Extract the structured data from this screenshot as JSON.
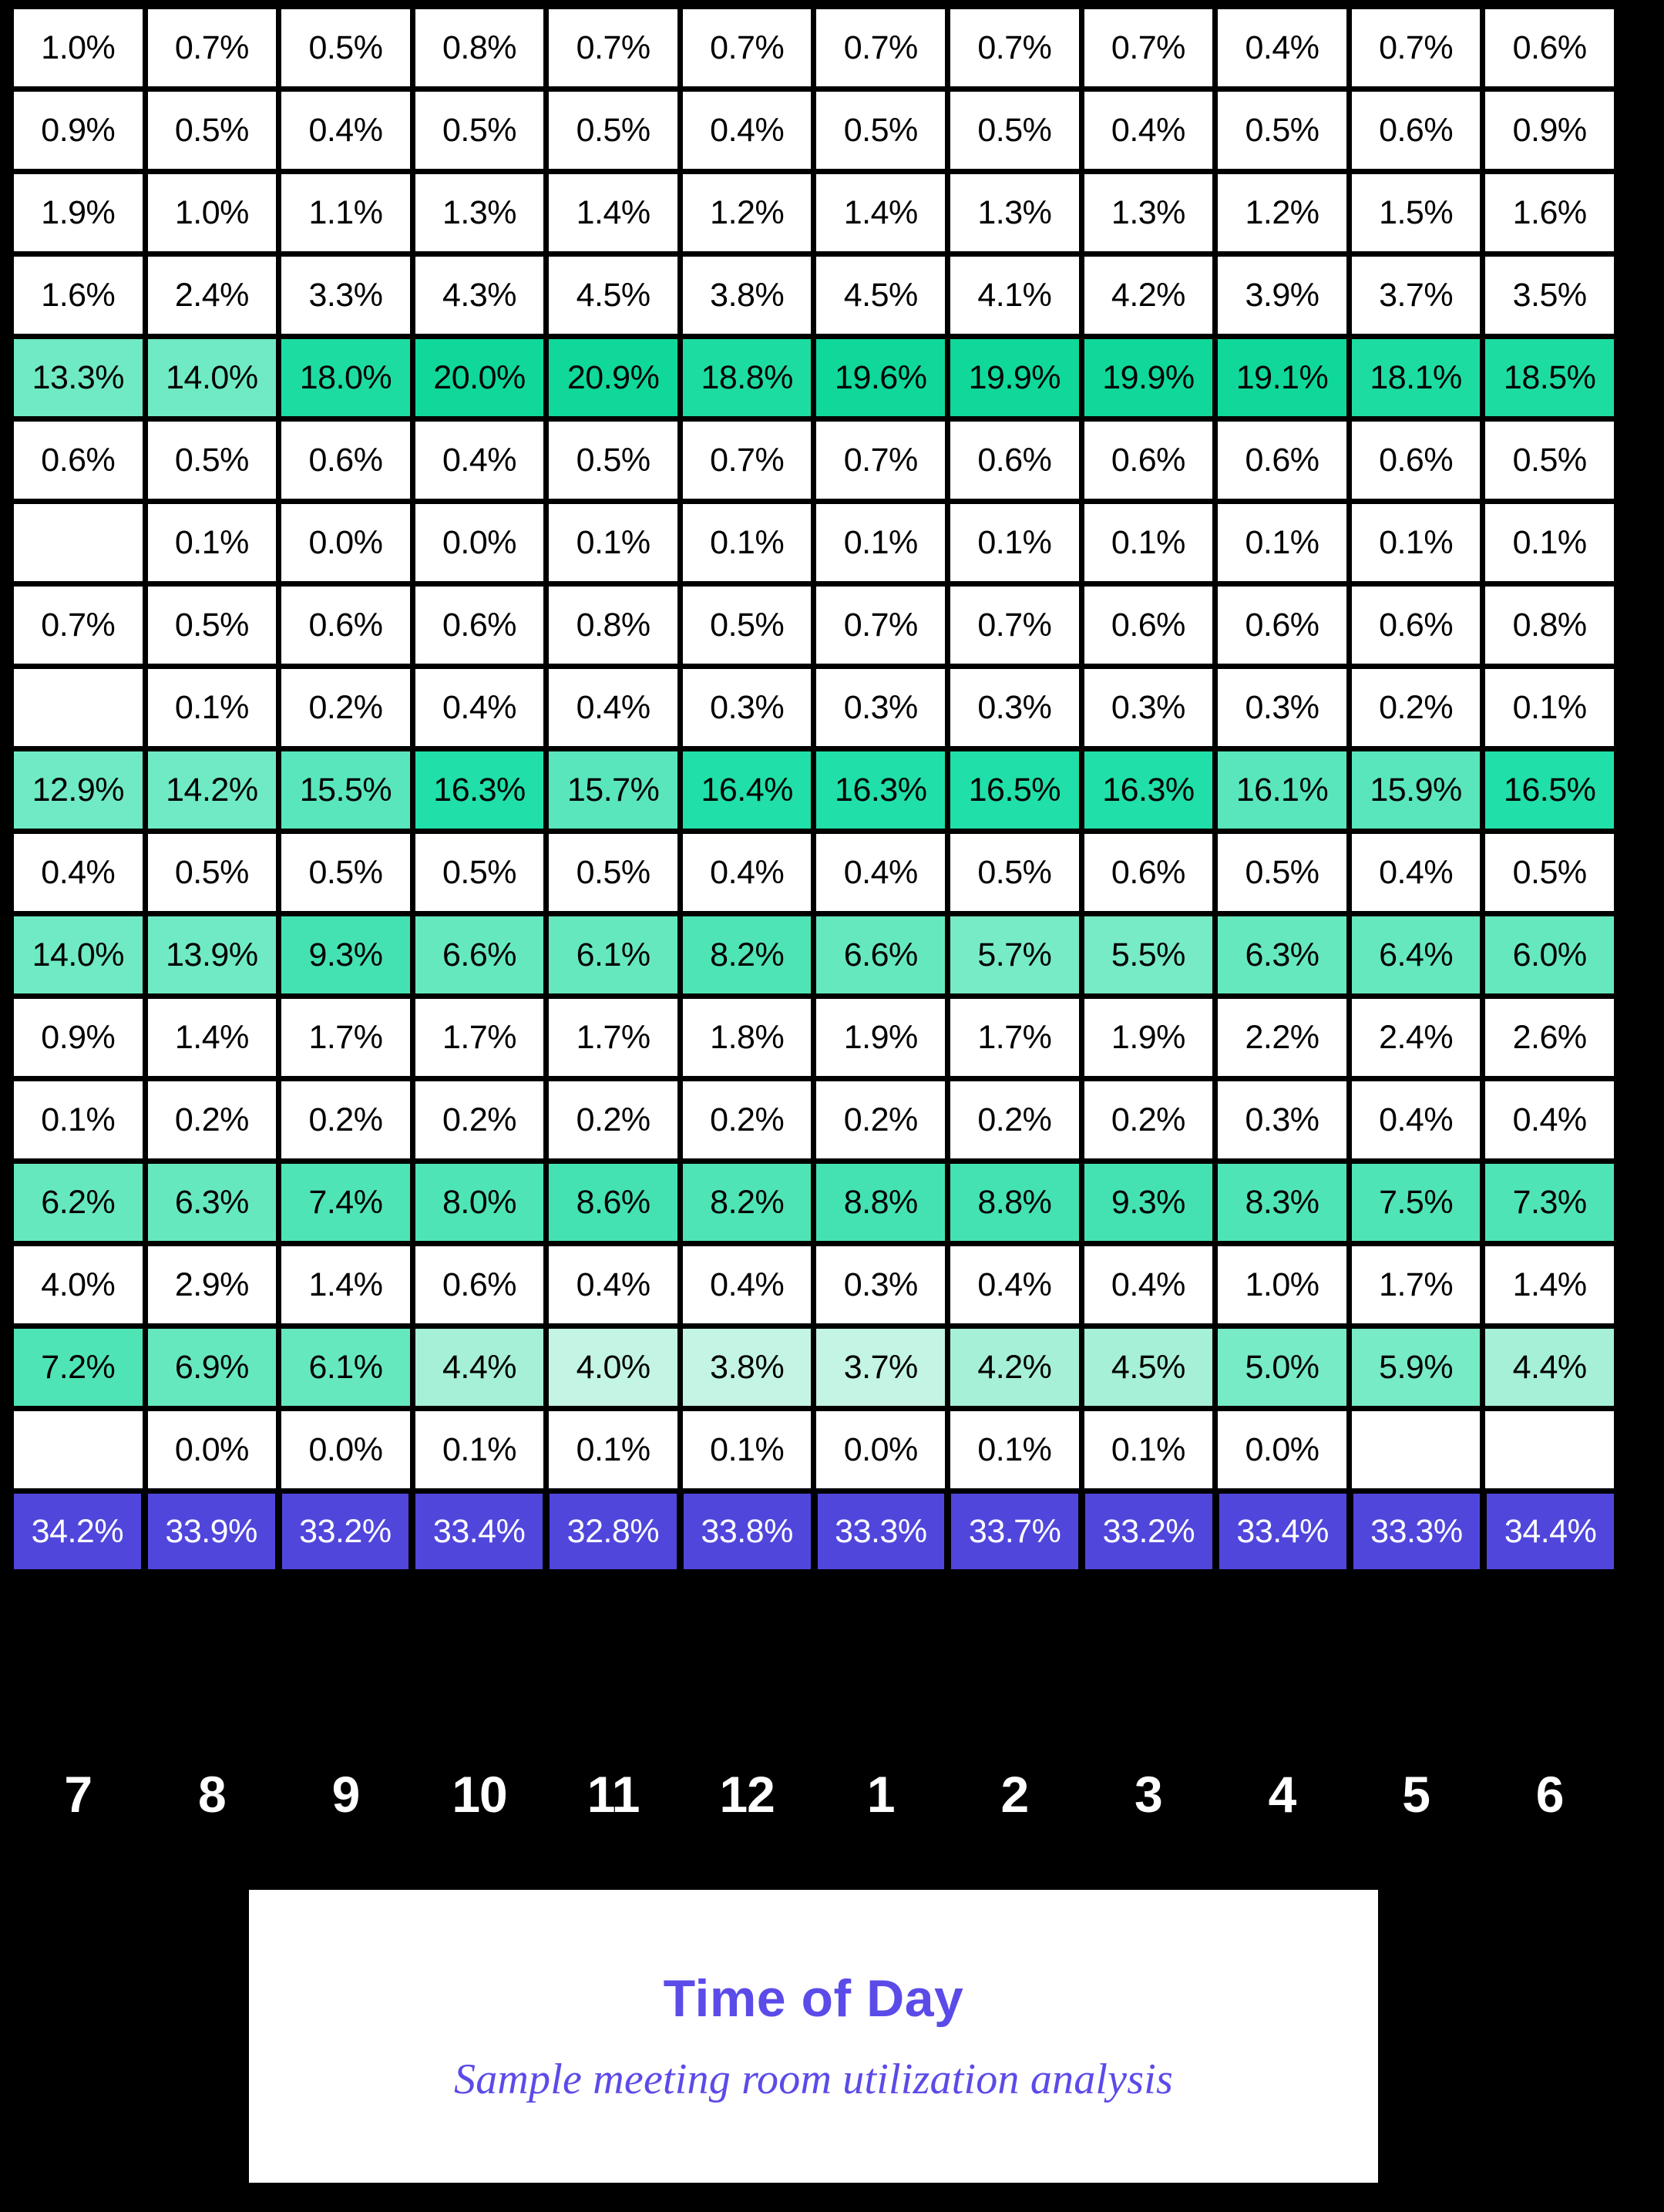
{
  "title": {
    "main": "Time of Day",
    "subtitle": "Sample meeting room utilization analysis",
    "color": "#5B4BE8"
  },
  "colors": {
    "background": "#000000",
    "cell_empty": "#ffffff",
    "text_dark": "#000000",
    "text_light": "#ffffff",
    "total_row": "#5046DC",
    "green_low": "#BDF3E2",
    "green_mid": "#7FEBC8",
    "green_high": "#4DE3B4",
    "green_max": "#10D89A"
  },
  "chart_data": {
    "type": "heatmap",
    "title": "Time of Day",
    "subtitle": "Sample meeting room utilization analysis",
    "xlabel": "Time of Day",
    "ylabel": "",
    "grid": true,
    "legend": "none",
    "x": [
      "7",
      "8",
      "9",
      "10",
      "11",
      "12",
      "1",
      "2",
      "3",
      "4",
      "5",
      "6"
    ],
    "categories": [
      "7",
      "8",
      "9",
      "10",
      "11",
      "12",
      "1",
      "2",
      "3",
      "4",
      "5",
      "6"
    ],
    "value_suffix": "%",
    "rows": [
      {
        "index": 1,
        "highlight": "none",
        "values": [
          "1.0%",
          "0.7%",
          "0.5%",
          "0.8%",
          "0.7%",
          "0.7%",
          "0.7%",
          "0.7%",
          "0.7%",
          "0.4%",
          "0.7%",
          "0.6%"
        ]
      },
      {
        "index": 2,
        "highlight": "none",
        "values": [
          "0.9%",
          "0.5%",
          "0.4%",
          "0.5%",
          "0.5%",
          "0.4%",
          "0.5%",
          "0.5%",
          "0.4%",
          "0.5%",
          "0.6%",
          "0.9%"
        ]
      },
      {
        "index": 3,
        "highlight": "none",
        "values": [
          "1.9%",
          "1.0%",
          "1.1%",
          "1.3%",
          "1.4%",
          "1.2%",
          "1.4%",
          "1.3%",
          "1.3%",
          "1.2%",
          "1.5%",
          "1.6%"
        ]
      },
      {
        "index": 4,
        "highlight": "none",
        "values": [
          "1.6%",
          "2.4%",
          "3.3%",
          "4.3%",
          "4.5%",
          "3.8%",
          "4.5%",
          "4.1%",
          "4.2%",
          "3.9%",
          "3.7%",
          "3.5%"
        ]
      },
      {
        "index": 5,
        "highlight": "green",
        "values": [
          "13.3%",
          "14.0%",
          "18.0%",
          "20.0%",
          "20.9%",
          "18.8%",
          "19.6%",
          "19.9%",
          "19.9%",
          "19.1%",
          "18.1%",
          "18.5%"
        ]
      },
      {
        "index": 6,
        "highlight": "none",
        "values": [
          "0.6%",
          "0.5%",
          "0.6%",
          "0.4%",
          "0.5%",
          "0.7%",
          "0.7%",
          "0.6%",
          "0.6%",
          "0.6%",
          "0.6%",
          "0.5%"
        ]
      },
      {
        "index": 7,
        "highlight": "none",
        "values": [
          "",
          "0.1%",
          "0.0%",
          "0.0%",
          "0.1%",
          "0.1%",
          "0.1%",
          "0.1%",
          "0.1%",
          "0.1%",
          "0.1%",
          "0.1%"
        ]
      },
      {
        "index": 8,
        "highlight": "none",
        "values": [
          "0.7%",
          "0.5%",
          "0.6%",
          "0.6%",
          "0.8%",
          "0.5%",
          "0.7%",
          "0.7%",
          "0.6%",
          "0.6%",
          "0.6%",
          "0.8%"
        ]
      },
      {
        "index": 9,
        "highlight": "none",
        "values": [
          "",
          "0.1%",
          "0.2%",
          "0.4%",
          "0.4%",
          "0.3%",
          "0.3%",
          "0.3%",
          "0.3%",
          "0.3%",
          "0.2%",
          "0.1%"
        ]
      },
      {
        "index": 10,
        "highlight": "green",
        "values": [
          "12.9%",
          "14.2%",
          "15.5%",
          "16.3%",
          "15.7%",
          "16.4%",
          "16.3%",
          "16.5%",
          "16.3%",
          "16.1%",
          "15.9%",
          "16.5%"
        ]
      },
      {
        "index": 11,
        "highlight": "none",
        "values": [
          "0.4%",
          "0.5%",
          "0.5%",
          "0.5%",
          "0.5%",
          "0.4%",
          "0.4%",
          "0.5%",
          "0.6%",
          "0.5%",
          "0.4%",
          "0.5%"
        ]
      },
      {
        "index": 12,
        "highlight": "green",
        "values": [
          "14.0%",
          "13.9%",
          "9.3%",
          "6.6%",
          "6.1%",
          "8.2%",
          "6.6%",
          "5.7%",
          "5.5%",
          "6.3%",
          "6.4%",
          "6.0%"
        ]
      },
      {
        "index": 13,
        "highlight": "none",
        "values": [
          "0.9%",
          "1.4%",
          "1.7%",
          "1.7%",
          "1.7%",
          "1.8%",
          "1.9%",
          "1.7%",
          "1.9%",
          "2.2%",
          "2.4%",
          "2.6%"
        ]
      },
      {
        "index": 14,
        "highlight": "none",
        "values": [
          "0.1%",
          "0.2%",
          "0.2%",
          "0.2%",
          "0.2%",
          "0.2%",
          "0.2%",
          "0.2%",
          "0.2%",
          "0.3%",
          "0.4%",
          "0.4%"
        ]
      },
      {
        "index": 15,
        "highlight": "green",
        "values": [
          "6.2%",
          "6.3%",
          "7.4%",
          "8.0%",
          "8.6%",
          "8.2%",
          "8.8%",
          "8.8%",
          "9.3%",
          "8.3%",
          "7.5%",
          "7.3%"
        ]
      },
      {
        "index": 16,
        "highlight": "none",
        "values": [
          "4.0%",
          "2.9%",
          "1.4%",
          "0.6%",
          "0.4%",
          "0.4%",
          "0.3%",
          "0.4%",
          "0.4%",
          "1.0%",
          "1.7%",
          "1.4%"
        ]
      },
      {
        "index": 17,
        "highlight": "green",
        "values": [
          "7.2%",
          "6.9%",
          "6.1%",
          "4.4%",
          "4.0%",
          "3.8%",
          "3.7%",
          "4.2%",
          "4.5%",
          "5.0%",
          "5.9%",
          "4.4%"
        ]
      },
      {
        "index": 18,
        "highlight": "none",
        "values": [
          "",
          "0.0%",
          "0.0%",
          "0.1%",
          "0.1%",
          "0.1%",
          "0.0%",
          "0.1%",
          "0.1%",
          "0.0%",
          "",
          ""
        ]
      },
      {
        "index": 19,
        "highlight": "total",
        "values": [
          "34.2%",
          "33.9%",
          "33.2%",
          "33.4%",
          "32.8%",
          "33.8%",
          "33.3%",
          "33.7%",
          "33.2%",
          "33.4%",
          "33.3%",
          "34.4%"
        ]
      }
    ]
  }
}
